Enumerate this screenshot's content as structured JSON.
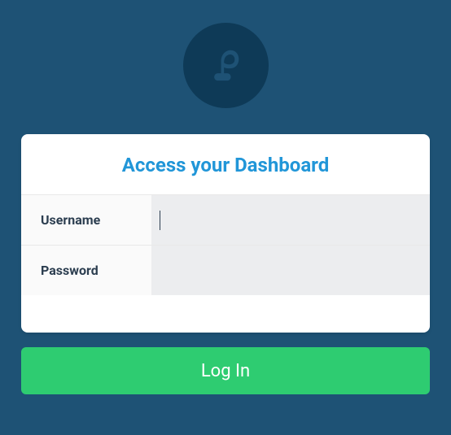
{
  "logo": {
    "name": "brand-logo"
  },
  "card": {
    "title": "Access your Dashboard",
    "fields": {
      "username": {
        "label": "Username",
        "value": ""
      },
      "password": {
        "label": "Password",
        "value": ""
      }
    }
  },
  "actions": {
    "login_label": "Log In"
  },
  "colors": {
    "background": "#1e5275",
    "logo_bg": "#0e3a57",
    "accent": "#2196d8",
    "button": "#2ecc71",
    "input_bg": "#ecedef",
    "text_dark": "#2c3e50"
  }
}
